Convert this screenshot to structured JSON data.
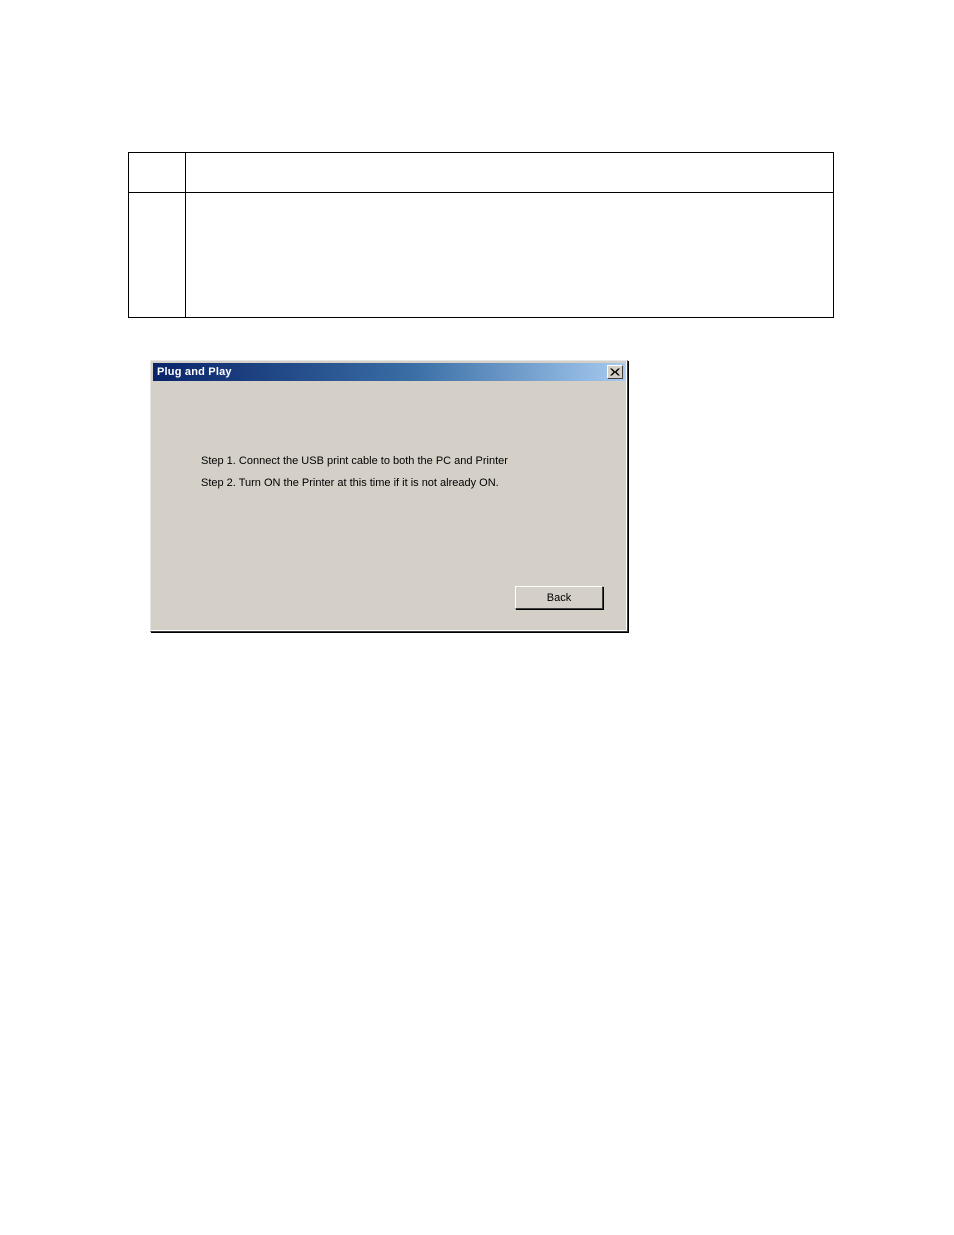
{
  "dialog": {
    "title": "Plug and Play",
    "step1": "Step 1.  Connect the USB print cable to both the PC and Printer",
    "step2": "Step 2.  Turn ON the Printer at this time if it is not already ON.",
    "back_label": "Back"
  }
}
